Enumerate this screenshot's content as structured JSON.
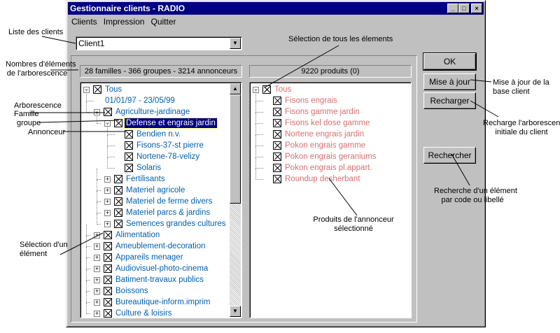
{
  "window": {
    "title": "Gestionnaire clients - RADIO",
    "controls": {
      "minimize": "_",
      "maximize": "□",
      "close": "×"
    }
  },
  "menu": [
    "Clients",
    "Impression",
    "Quitter"
  ],
  "client_combo": {
    "value": "Client1",
    "arrow": "▼"
  },
  "tree_summary": "28 familles - 366 groupes - 3214 annonceurs",
  "products_summary": "9220 produits (0)",
  "tree": [
    {
      "label": "Tous",
      "depth": 0,
      "expander": "−",
      "checkbox": true,
      "color": "blue"
    },
    {
      "label": "01/01/97 - 23/05/99",
      "depth": 1,
      "expander": null,
      "checkbox": false,
      "color": "blue"
    },
    {
      "label": "Agriculture-jardinage",
      "depth": 1,
      "expander": "−",
      "checkbox": true,
      "color": "blue"
    },
    {
      "label": "Defense et engrais jardin",
      "depth": 2,
      "expander": "−",
      "checkbox": true,
      "color": "sel"
    },
    {
      "label": "Bendien n.v.",
      "depth": 3,
      "expander": null,
      "checkbox": true,
      "color": "blue"
    },
    {
      "label": "Fisons-37-st pierre",
      "depth": 3,
      "expander": null,
      "checkbox": true,
      "color": "blue"
    },
    {
      "label": "Nortene-78-velizy",
      "depth": 3,
      "expander": null,
      "checkbox": true,
      "color": "blue"
    },
    {
      "label": "Solaris",
      "depth": 3,
      "expander": null,
      "checkbox": true,
      "color": "blue"
    },
    {
      "label": "Fertilisants",
      "depth": 2,
      "expander": "+",
      "checkbox": true,
      "color": "blue"
    },
    {
      "label": "Materiel agricole",
      "depth": 2,
      "expander": "+",
      "checkbox": true,
      "color": "blue"
    },
    {
      "label": "Materiel de ferme divers",
      "depth": 2,
      "expander": "+",
      "checkbox": true,
      "color": "blue"
    },
    {
      "label": "Materiel parcs & jardins",
      "depth": 2,
      "expander": "+",
      "checkbox": true,
      "color": "blue"
    },
    {
      "label": "Semences grandes cultures",
      "depth": 2,
      "expander": "+",
      "checkbox": true,
      "color": "blue"
    },
    {
      "label": "Alimentation",
      "depth": 1,
      "expander": "+",
      "checkbox": true,
      "color": "blue"
    },
    {
      "label": "Ameublement-decoration",
      "depth": 1,
      "expander": "+",
      "checkbox": true,
      "color": "blue"
    },
    {
      "label": "Appareils menager",
      "depth": 1,
      "expander": "+",
      "checkbox": true,
      "color": "blue"
    },
    {
      "label": "Audiovisuel-photo-cinema",
      "depth": 1,
      "expander": "+",
      "checkbox": true,
      "color": "blue"
    },
    {
      "label": "Batiment-travaux publics",
      "depth": 1,
      "expander": "+",
      "checkbox": true,
      "color": "blue"
    },
    {
      "label": "Boissons",
      "depth": 1,
      "expander": "+",
      "checkbox": true,
      "color": "blue"
    },
    {
      "label": "Bureautique-inform.imprim",
      "depth": 1,
      "expander": "+",
      "checkbox": true,
      "color": "blue"
    },
    {
      "label": "Culture & loisirs",
      "depth": 1,
      "expander": "+",
      "checkbox": true,
      "color": "blue"
    }
  ],
  "products": [
    {
      "label": "Tous",
      "depth": 0,
      "expander": "−"
    },
    {
      "label": "Fisons engrais",
      "depth": 1
    },
    {
      "label": "Fisons gamme jardin",
      "depth": 1
    },
    {
      "label": "Fisons kel dose gamme",
      "depth": 1
    },
    {
      "label": "Nortene engrais jardin",
      "depth": 1
    },
    {
      "label": "Pokon engrais gamme",
      "depth": 1
    },
    {
      "label": "Pokon engrais geraniums",
      "depth": 1
    },
    {
      "label": "Pokon engrais pl.appart.",
      "depth": 1
    },
    {
      "label": "Roundup desherbant",
      "depth": 1
    }
  ],
  "buttons": {
    "ok": "OK",
    "update": "Mise à jour",
    "reload": "Recharger",
    "search": "Rechercher"
  },
  "scroll": {
    "up": "▲",
    "down": "▼"
  },
  "annotations": {
    "client_list": "Liste des clients",
    "counts": [
      "Nombres d'éléments",
      "de l'arborescence"
    ],
    "tree": "Arborescence",
    "family": "Famille",
    "group": "groupe",
    "advertiser": "Annonceur",
    "select_all": "Sélection de tous les élements",
    "select_one": [
      "Sélection d'un",
      "élément"
    ],
    "advertiser_products": [
      "Produits de l'annonceur",
      "sélectionné"
    ],
    "update_desc": [
      "Mise à jour de la",
      "base client"
    ],
    "reload_desc": [
      "Recharge l'arborescence",
      "initiale du client"
    ],
    "search_desc": [
      "Recherche d'un élément",
      "par code ou libellé"
    ]
  }
}
